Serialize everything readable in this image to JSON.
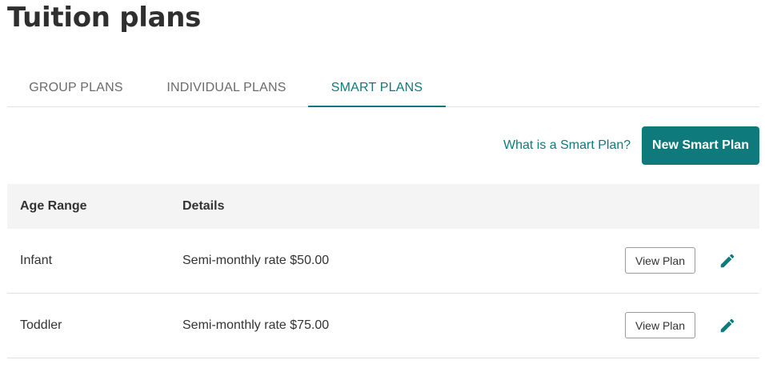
{
  "page": {
    "title": "Tuition plans"
  },
  "tabs": [
    {
      "label": "GROUP PLANS",
      "active": false
    },
    {
      "label": "INDIVIDUAL PLANS",
      "active": false
    },
    {
      "label": "SMART PLANS",
      "active": true
    }
  ],
  "toolbar": {
    "help_link": "What is a Smart Plan?",
    "new_button": "New Smart Plan"
  },
  "table": {
    "headers": [
      "Age Range",
      "Details"
    ],
    "rows": [
      {
        "age_range": "Infant",
        "details": "Semi-monthly rate $50.00",
        "view_label": "View Plan",
        "edit_icon": "pencil-icon"
      },
      {
        "age_range": "Toddler",
        "details": "Semi-monthly rate $75.00",
        "view_label": "View Plan",
        "edit_icon": "pencil-icon"
      }
    ]
  },
  "colors": {
    "accent": "#0f7a7c",
    "header_bg": "#f4f4f4",
    "text": "#333333",
    "tab_inactive": "#6b6b6b"
  }
}
